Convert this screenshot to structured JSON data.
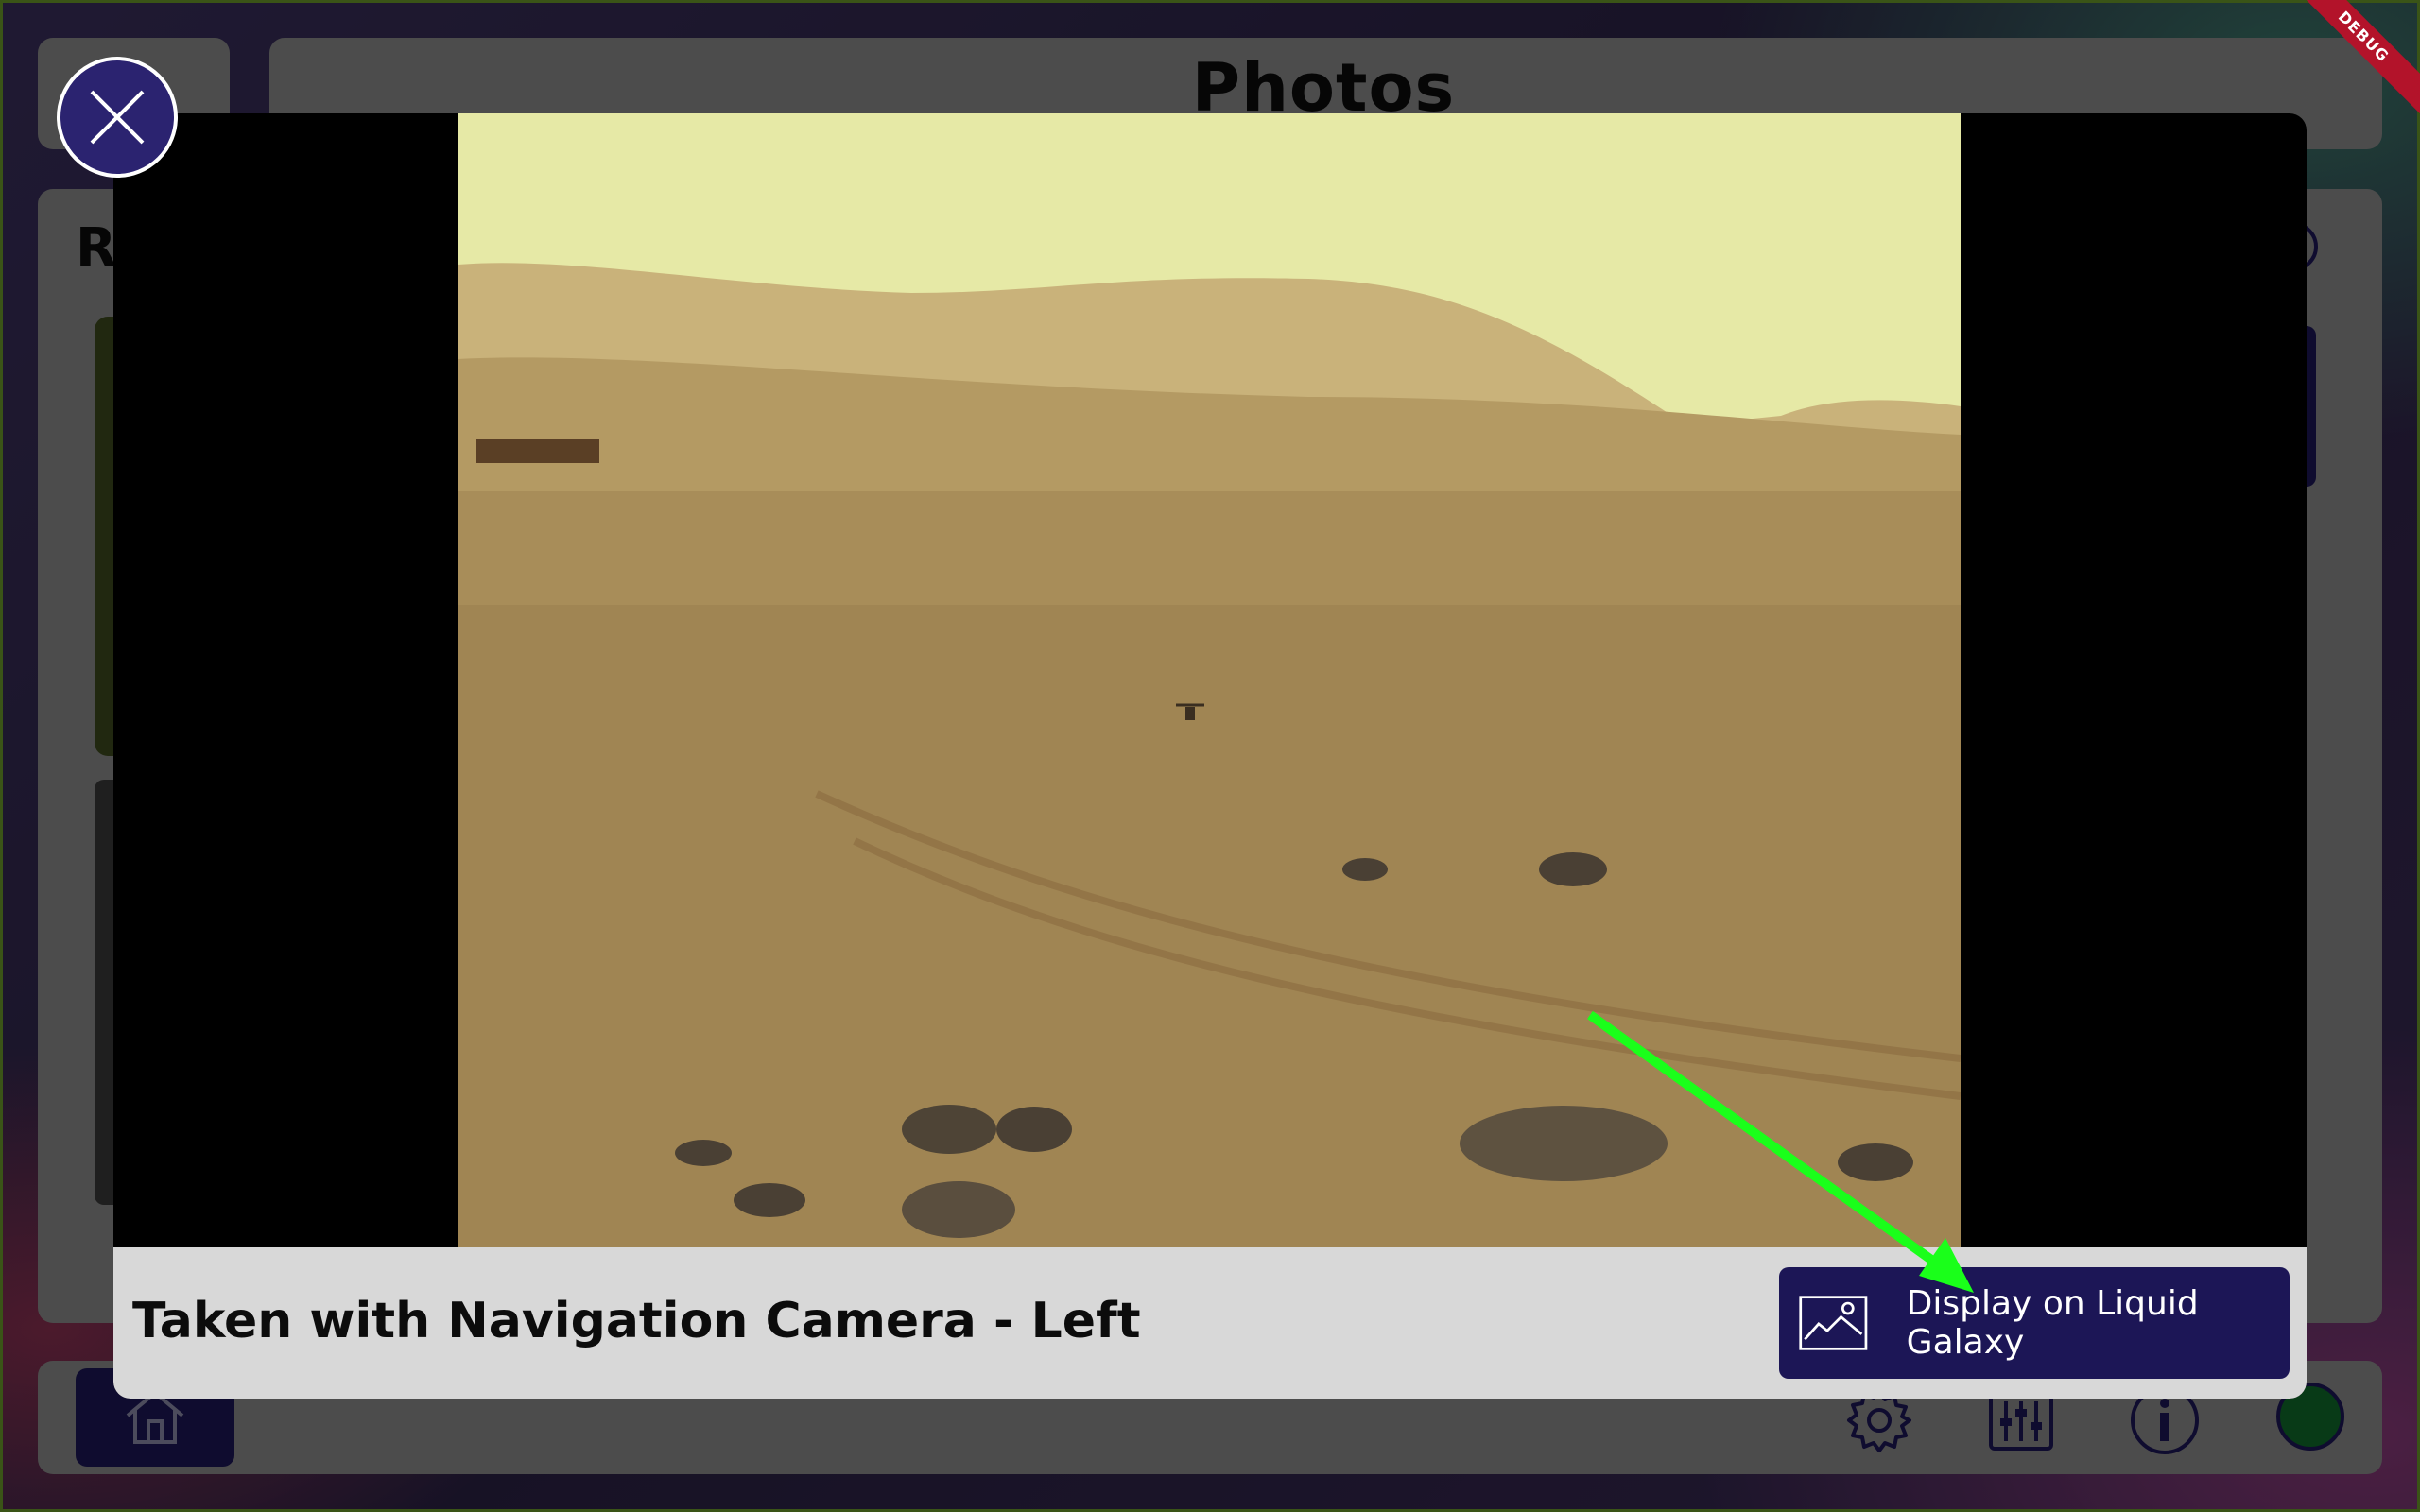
{
  "app": {
    "title": "Photos",
    "section_heading_partial": "R"
  },
  "modal": {
    "caption": "Taken with Navigation Camera - Left",
    "display_button_label": "Display on Liquid Galaxy",
    "close_icon": "close-icon",
    "display_icon": "image-icon"
  },
  "bottom_bar": {
    "icons": [
      "home-icon",
      "settings-icon",
      "sliders-icon",
      "info-icon",
      "status-dot"
    ]
  },
  "debug_banner": "DEBUG",
  "colors": {
    "primary": "#1c1656",
    "modal_bg": "#000000",
    "caption_bg": "#d8d8d8",
    "status_green": "#0f6b2a",
    "annotation_arrow": "#1aff1a"
  }
}
